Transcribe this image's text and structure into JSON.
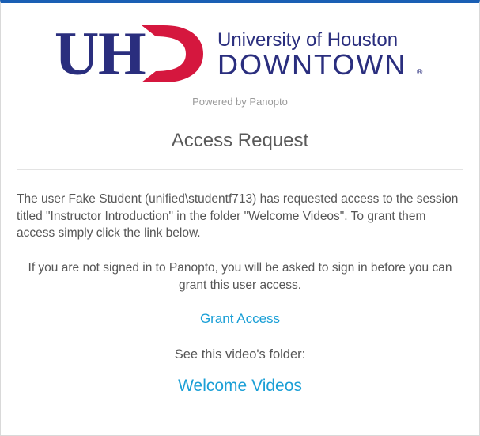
{
  "logo": {
    "powered_by": "Powered by Panopto",
    "univ_top": "University of Houston",
    "univ_bottom": "DOWNTOWN"
  },
  "title": "Access Request",
  "message1": "The user Fake Student (unified\\studentf713) has requested access to the session titled \"Instructor Introduction\" in the folder \"Welcome Videos\". To grant them access simply click the link below.",
  "message2": "If you are not signed in to Panopto, you will be asked to sign in before you can grant this user access.",
  "grant_link": "Grant Access",
  "folder_label": "See this video's folder:",
  "folder_link": "Welcome Videos",
  "colors": {
    "accent": "#1a9fd6",
    "border_top": "#1a5fb4",
    "logo_blue": "#2a2e7e",
    "logo_red": "#d5173e"
  }
}
